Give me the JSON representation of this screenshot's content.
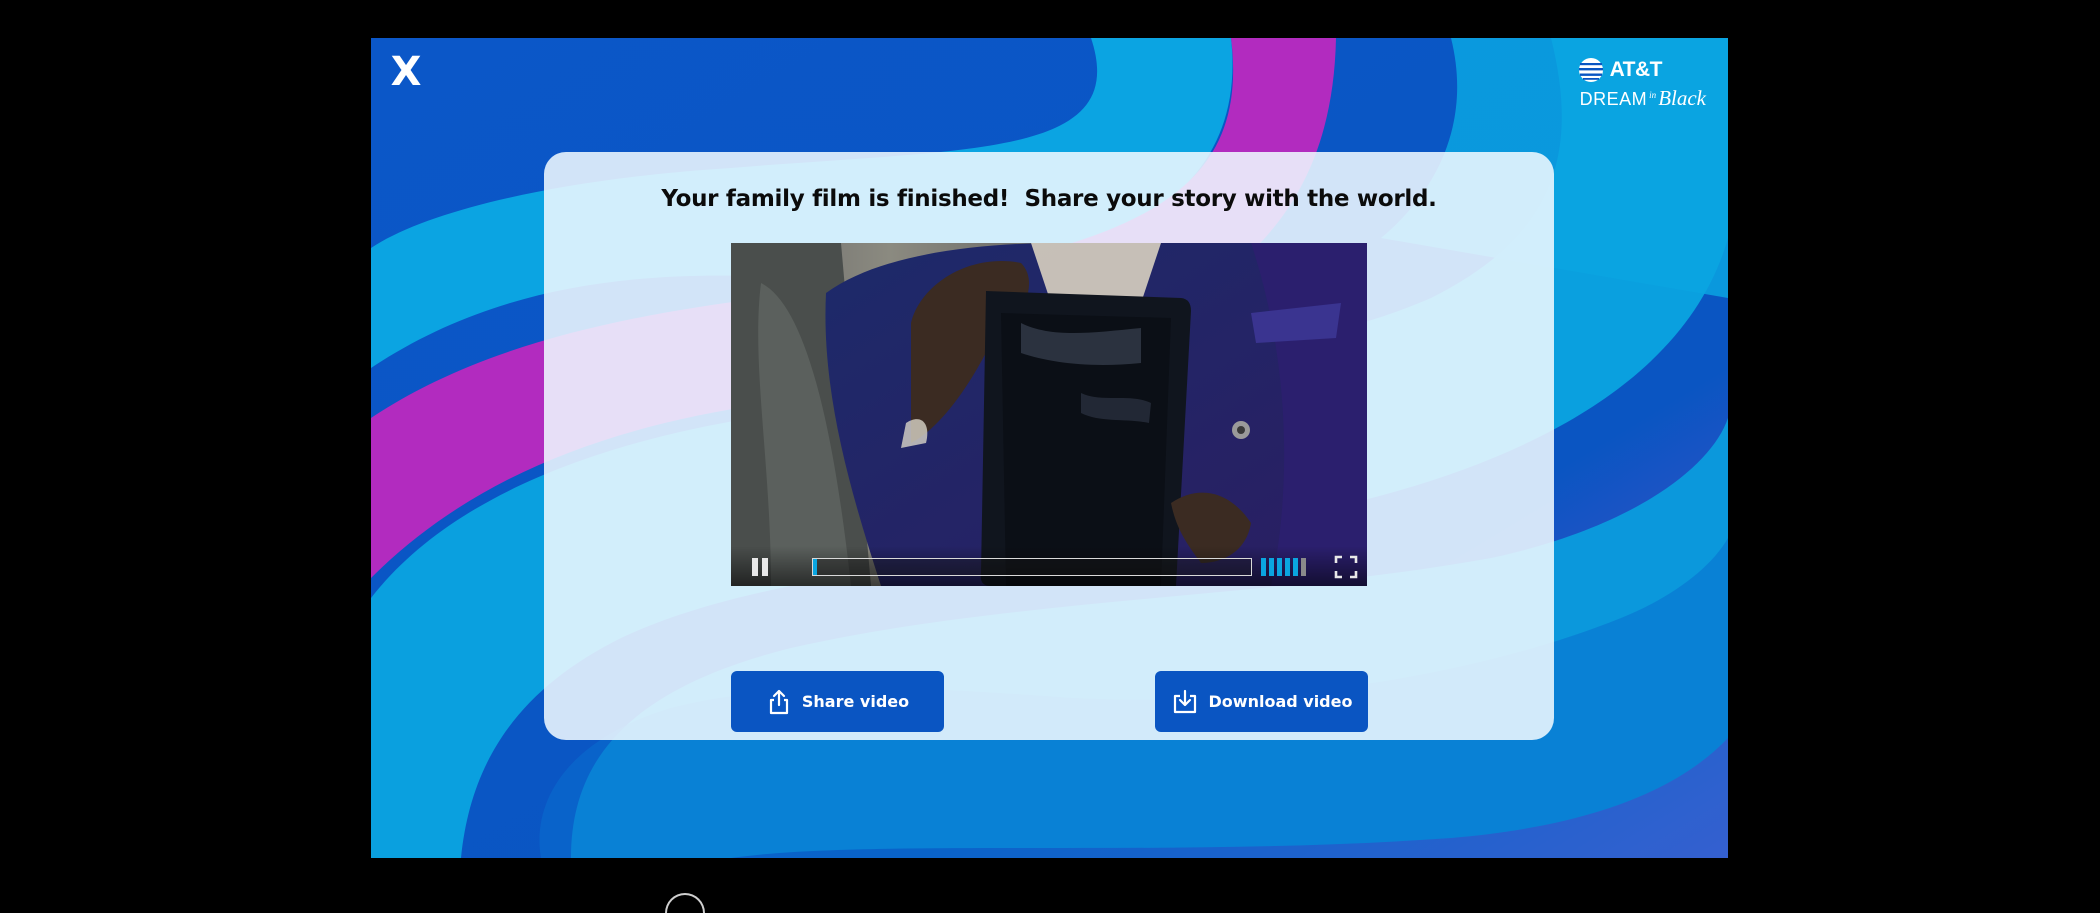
{
  "close_label": "X",
  "brand": {
    "att": "AT&T",
    "dream": "DREAM",
    "in": "in",
    "black": "Black"
  },
  "headline": "Your family film is finished!  Share your story with the world.",
  "video": {
    "state": "playing",
    "progress_fraction": 0.01,
    "volume_level_fraction": 0.83
  },
  "share_button": {
    "label": "Share video",
    "icon": "share-icon"
  },
  "download_button": {
    "label": "Download video",
    "icon": "download-icon"
  },
  "colors": {
    "accent": "#0a55c2",
    "progress": "#0aa5e0",
    "magenta": "#b22bbf",
    "cyan": "#0ba4e2"
  }
}
